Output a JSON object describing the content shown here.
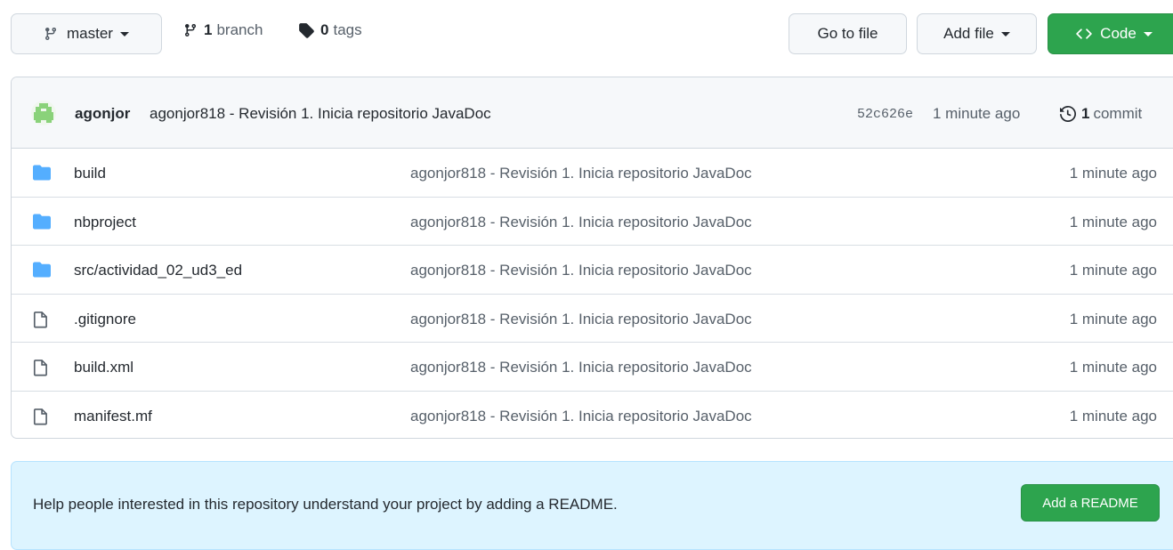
{
  "toolbar": {
    "branch_select": "master",
    "branches_count": "1",
    "branches_label": "branch",
    "tags_count": "0",
    "tags_label": "tags",
    "go_to_file": "Go to file",
    "add_file": "Add file",
    "code": "Code"
  },
  "commit": {
    "author": "agonjor",
    "message": "agonjor818 - Revisión 1. Inicia repositorio JavaDoc",
    "sha": "52c626e",
    "time": "1 minute ago",
    "count": "1",
    "count_label": "commit"
  },
  "files": [
    {
      "type": "folder",
      "name": "build",
      "message": "agonjor818 - Revisión 1. Inicia repositorio JavaDoc",
      "age": "1 minute ago"
    },
    {
      "type": "folder",
      "name": "nbproject",
      "message": "agonjor818 - Revisión 1. Inicia repositorio JavaDoc",
      "age": "1 minute ago"
    },
    {
      "type": "folder",
      "name": "src/actividad_02_ud3_ed",
      "message": "agonjor818 - Revisión 1. Inicia repositorio JavaDoc",
      "age": "1 minute ago"
    },
    {
      "type": "file",
      "name": ".gitignore",
      "message": "agonjor818 - Revisión 1. Inicia repositorio JavaDoc",
      "age": "1 minute ago"
    },
    {
      "type": "file",
      "name": "build.xml",
      "message": "agonjor818 - Revisión 1. Inicia repositorio JavaDoc",
      "age": "1 minute ago"
    },
    {
      "type": "file",
      "name": "manifest.mf",
      "message": "agonjor818 - Revisión 1. Inicia repositorio JavaDoc",
      "age": "1 minute ago"
    }
  ],
  "readme": {
    "text": "Help people interested in this repository understand your project by adding a README.",
    "button": "Add a README"
  },
  "colors": {
    "green": "#2da44e",
    "folder": "#54aeff",
    "readme_bg": "#ddf4ff"
  }
}
